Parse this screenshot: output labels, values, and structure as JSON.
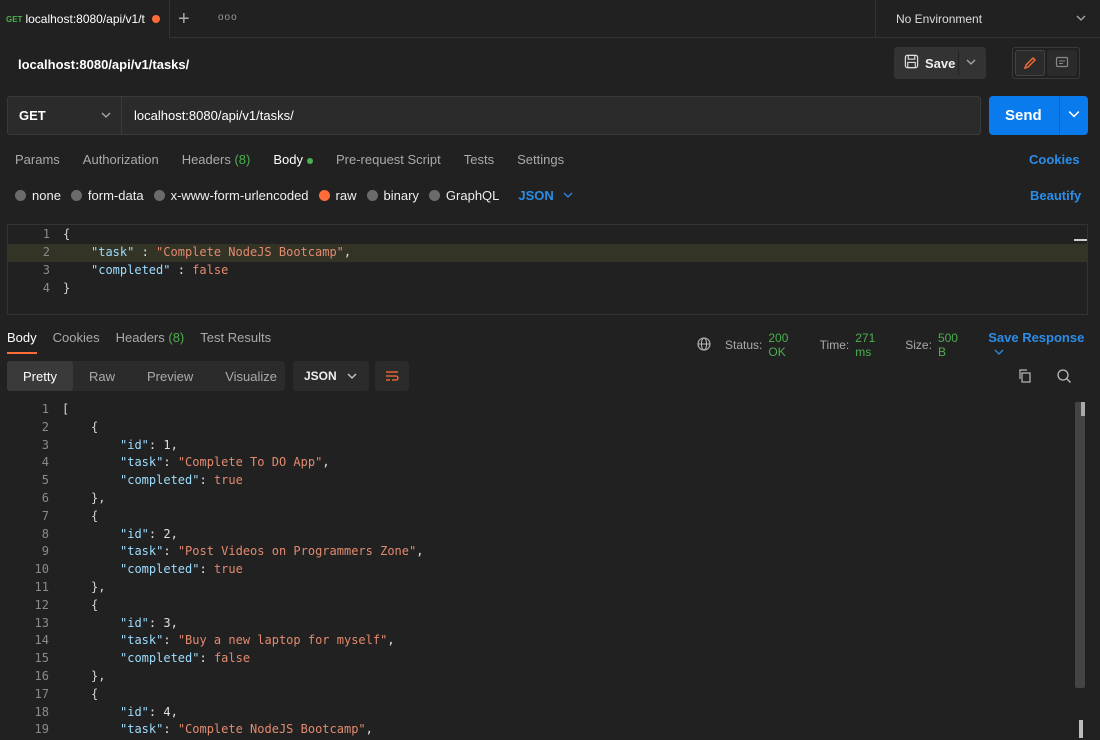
{
  "tab": {
    "method": "GET",
    "title": "localhost:8080/api/v1/t"
  },
  "environment": "No Environment",
  "request": {
    "title": "localhost:8080/api/v1/tasks/",
    "save_label": "Save",
    "method": "GET",
    "url": "localhost:8080/api/v1/tasks/",
    "send_label": "Send"
  },
  "req_tabs": {
    "params": "Params",
    "authorization": "Authorization",
    "headers": "Headers",
    "headers_count": "(8)",
    "body": "Body",
    "prerequest": "Pre-request Script",
    "tests": "Tests",
    "settings": "Settings",
    "cookies": "Cookies"
  },
  "body_types": {
    "none": "none",
    "form_data": "form-data",
    "urlencoded": "x-www-form-urlencoded",
    "raw": "raw",
    "binary": "binary",
    "graphql": "GraphQL",
    "format": "JSON",
    "beautify": "Beautify"
  },
  "request_body": {
    "line_numbers": [
      "1",
      "2",
      "3",
      "4"
    ],
    "open": "{",
    "task_key": "\"task\"",
    "task_value": "\"Complete NodeJS Bootcamp\"",
    "completed_key": "\"completed\"",
    "completed_value": "false",
    "close": "}"
  },
  "response_tabs": {
    "body": "Body",
    "cookies": "Cookies",
    "headers": "Headers",
    "headers_count": "(8)",
    "test_results": "Test Results"
  },
  "response_meta": {
    "status_label": "Status:",
    "status_value": "200 OK",
    "time_label": "Time:",
    "time_value": "271 ms",
    "size_label": "Size:",
    "size_value": "500 B",
    "save_response": "Save Response"
  },
  "view_tabs": {
    "pretty": "Pretty",
    "raw": "Raw",
    "preview": "Preview",
    "visualize": "Visualize",
    "format": "JSON"
  },
  "response_body": {
    "lines": [
      {
        "n": "1",
        "indent": 0,
        "text": "["
      },
      {
        "n": "2",
        "indent": 1,
        "text": "{"
      },
      {
        "n": "3",
        "indent": 2,
        "key": "\"id\"",
        "val": "1",
        "comma": true,
        "type": "num"
      },
      {
        "n": "4",
        "indent": 2,
        "key": "\"task\"",
        "val": "\"Complete To DO App\"",
        "comma": true,
        "type": "str"
      },
      {
        "n": "5",
        "indent": 2,
        "key": "\"completed\"",
        "val": "true",
        "comma": false,
        "type": "bool"
      },
      {
        "n": "6",
        "indent": 1,
        "text": "},"
      },
      {
        "n": "7",
        "indent": 1,
        "text": "{"
      },
      {
        "n": "8",
        "indent": 2,
        "key": "\"id\"",
        "val": "2",
        "comma": true,
        "type": "num"
      },
      {
        "n": "9",
        "indent": 2,
        "key": "\"task\"",
        "val": "\"Post Videos on Programmers Zone\"",
        "comma": true,
        "type": "str"
      },
      {
        "n": "10",
        "indent": 2,
        "key": "\"completed\"",
        "val": "true",
        "comma": false,
        "type": "bool"
      },
      {
        "n": "11",
        "indent": 1,
        "text": "},"
      },
      {
        "n": "12",
        "indent": 1,
        "text": "{"
      },
      {
        "n": "13",
        "indent": 2,
        "key": "\"id\"",
        "val": "3",
        "comma": true,
        "type": "num"
      },
      {
        "n": "14",
        "indent": 2,
        "key": "\"task\"",
        "val": "\"Buy a new laptop for myself\"",
        "comma": true,
        "type": "str"
      },
      {
        "n": "15",
        "indent": 2,
        "key": "\"completed\"",
        "val": "false",
        "comma": false,
        "type": "bool"
      },
      {
        "n": "16",
        "indent": 1,
        "text": "},"
      },
      {
        "n": "17",
        "indent": 1,
        "text": "{"
      },
      {
        "n": "18",
        "indent": 2,
        "key": "\"id\"",
        "val": "4",
        "comma": true,
        "type": "num"
      },
      {
        "n": "19",
        "indent": 2,
        "key": "\"task\"",
        "val": "\"Complete NodeJS Bootcamp\"",
        "comma": true,
        "type": "str"
      }
    ]
  },
  "colors": {
    "accent": "#ff6c37",
    "send": "#097bed",
    "link": "#2b8de8",
    "success": "#4caf50"
  }
}
